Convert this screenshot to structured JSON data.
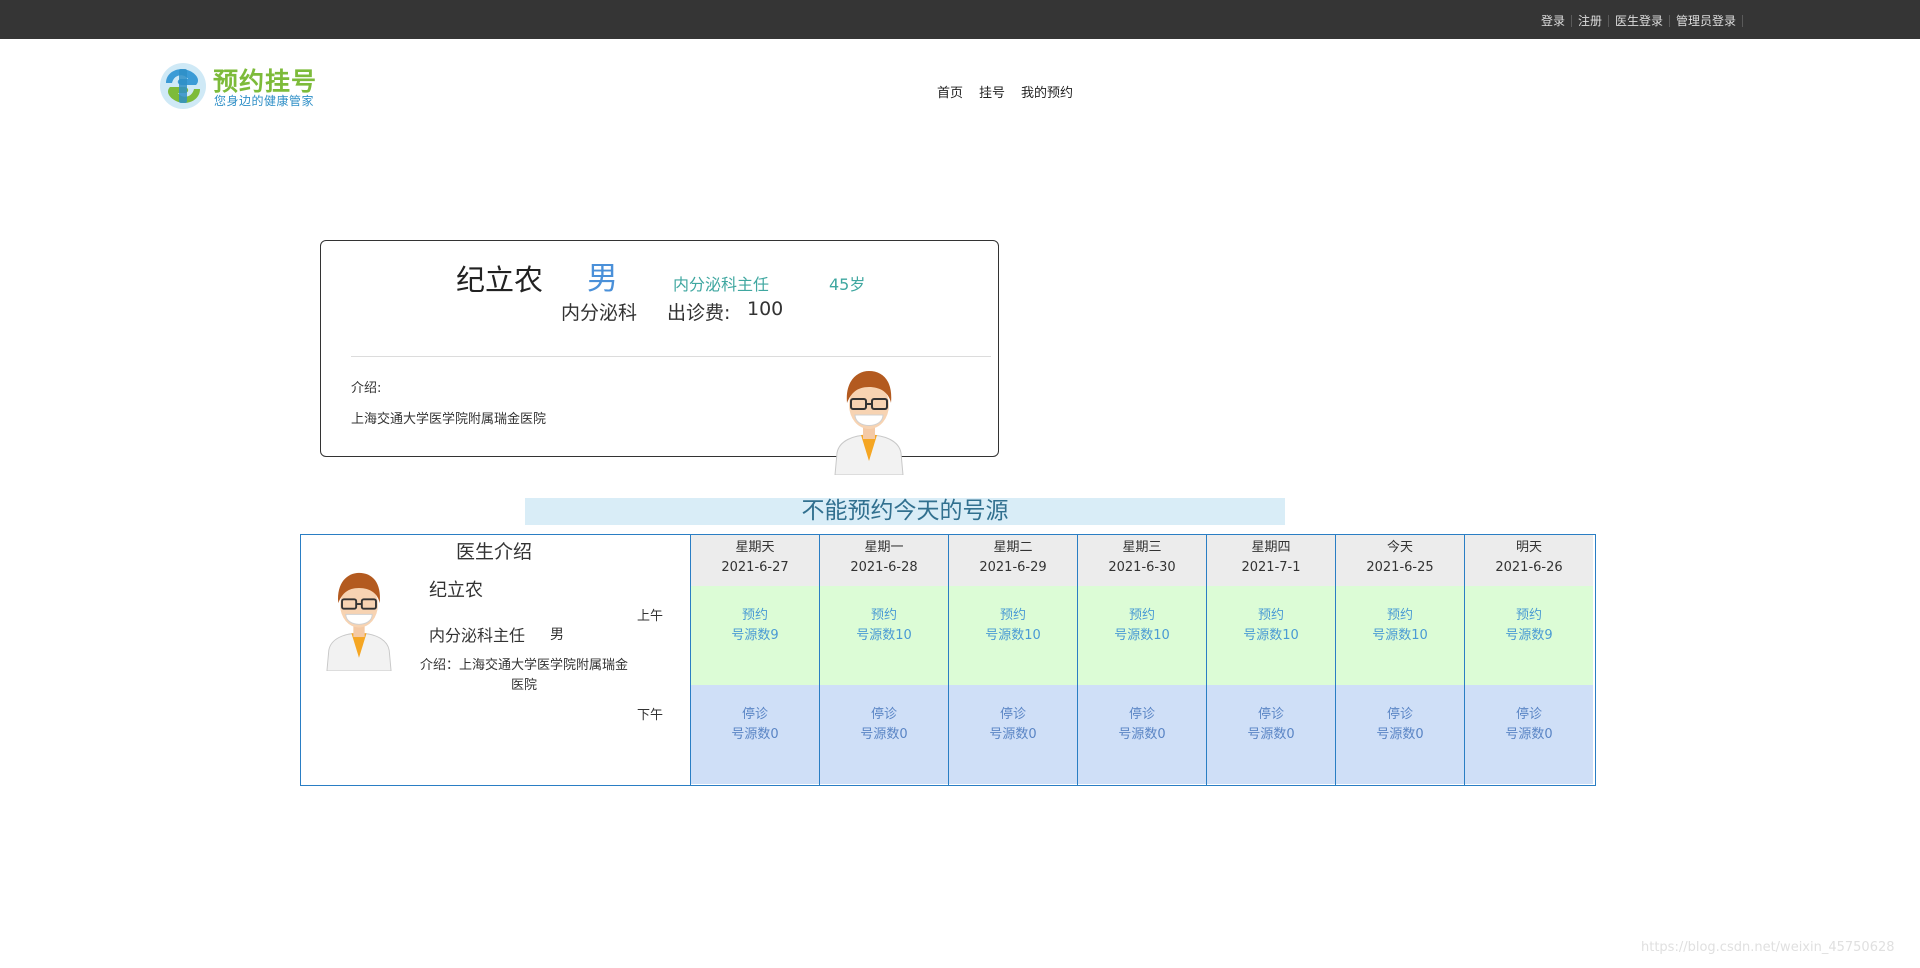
{
  "topbar": {
    "links": [
      "登录",
      "注册",
      "医生登录",
      "管理员登录"
    ]
  },
  "logo": {
    "title": "预约挂号",
    "slogan": "您身边的健康管家"
  },
  "nav": [
    "首页",
    "挂号",
    "我的预约"
  ],
  "doctor": {
    "name": "纪立农",
    "gender": "男",
    "title": "内分泌科主任",
    "age": "45岁",
    "dept": "内分泌科",
    "fee_label": "出诊费:",
    "fee": "100",
    "intro_label": "介绍:",
    "intro": "上海交通大学医学院附属瑞金医院"
  },
  "notice": "不能预约今天的号源",
  "schedule": {
    "heading": "医生介绍",
    "name": "纪立农",
    "title": "内分泌科主任",
    "gender": "男",
    "intro": "介绍：上海交通大学医学院附属瑞金医院",
    "am_label": "上午",
    "pm_label": "下午",
    "days": [
      {
        "weekday": "星期天",
        "date": "2021-6-27",
        "am_status": "预约",
        "am_count": "号源数9",
        "pm_status": "停诊",
        "pm_count": "号源数0"
      },
      {
        "weekday": "星期一",
        "date": "2021-6-28",
        "am_status": "预约",
        "am_count": "号源数10",
        "pm_status": "停诊",
        "pm_count": "号源数0"
      },
      {
        "weekday": "星期二",
        "date": "2021-6-29",
        "am_status": "预约",
        "am_count": "号源数10",
        "pm_status": "停诊",
        "pm_count": "号源数0"
      },
      {
        "weekday": "星期三",
        "date": "2021-6-30",
        "am_status": "预约",
        "am_count": "号源数10",
        "pm_status": "停诊",
        "pm_count": "号源数0"
      },
      {
        "weekday": "星期四",
        "date": "2021-7-1",
        "am_status": "预约",
        "am_count": "号源数10",
        "pm_status": "停诊",
        "pm_count": "号源数0"
      },
      {
        "weekday": "今天",
        "date": "2021-6-25",
        "am_status": "预约",
        "am_count": "号源数10",
        "pm_status": "停诊",
        "pm_count": "号源数0"
      },
      {
        "weekday": "明天",
        "date": "2021-6-26",
        "am_status": "预约",
        "am_count": "号源数9",
        "pm_status": "停诊",
        "pm_count": "号源数0"
      }
    ]
  },
  "watermark": "https://blog.csdn.net/weixin_45750628"
}
